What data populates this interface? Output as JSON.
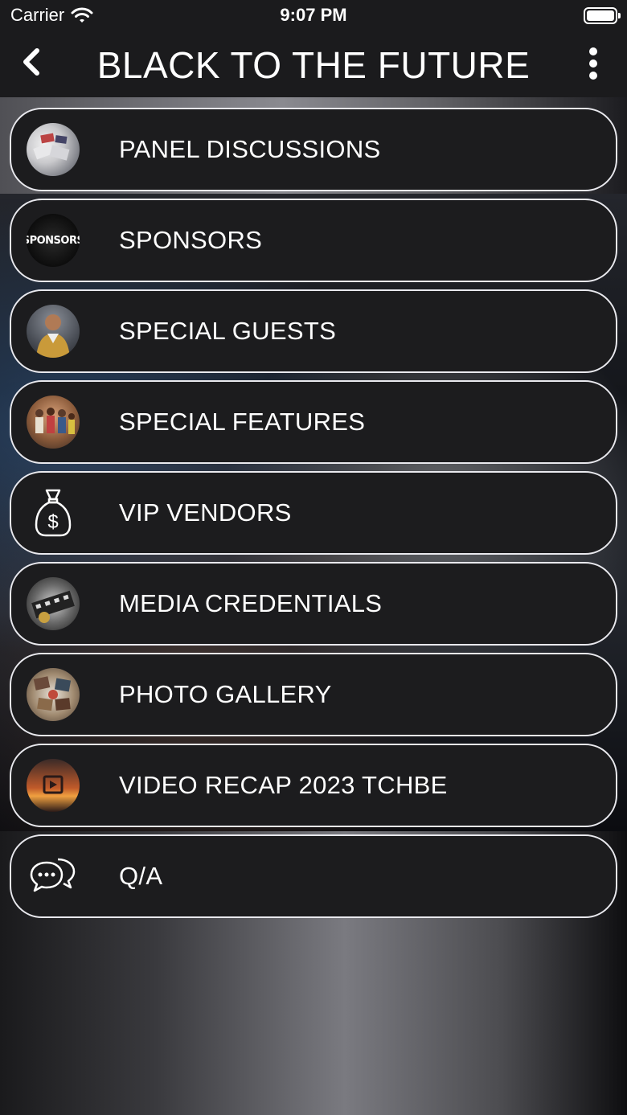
{
  "status_bar": {
    "carrier": "Carrier",
    "time": "9:07 PM"
  },
  "nav": {
    "title": "BLACK TO THE FUTURE",
    "back_icon": "chevron-left-icon",
    "more_icon": "more-vertical-icon"
  },
  "menu": {
    "items": [
      {
        "label": "PANEL DISCUSSIONS",
        "icon": "panel-photo-thumbnail"
      },
      {
        "label": "SPONSORS",
        "icon": "sponsors-thumbnail",
        "thumb_text": "SPONSORS"
      },
      {
        "label": "SPECIAL GUESTS",
        "icon": "guest-photo-thumbnail"
      },
      {
        "label": "SPECIAL FEATURES",
        "icon": "features-photo-thumbnail"
      },
      {
        "label": "VIP VENDORS",
        "icon": "money-bag-icon"
      },
      {
        "label": "MEDIA CREDENTIALS",
        "icon": "media-photo-thumbnail"
      },
      {
        "label": "PHOTO GALLERY",
        "icon": "gallery-photo-thumbnail"
      },
      {
        "label": "VIDEO RECAP 2023 TCHBE",
        "icon": "video-play-thumbnail"
      },
      {
        "label": "Q/A",
        "icon": "chat-bubbles-icon"
      }
    ]
  },
  "colors": {
    "bar_background": "#1b1b1d",
    "item_background": "#1c1c1e",
    "item_border": "#e9e9ee",
    "text": "#ffffff"
  }
}
